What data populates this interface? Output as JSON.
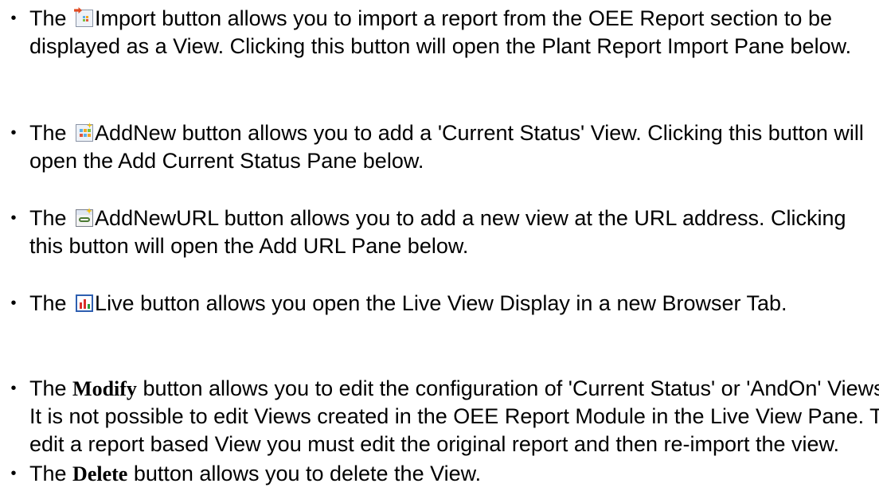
{
  "items": [
    {
      "lead": "The",
      "icon": "import-icon",
      "text": "Import button allows you to import a report from the OEE Report section to be displayed as a View. Clicking this button will open the Plant Report Import Pane below."
    },
    {
      "lead": "The",
      "icon": "add-new-icon",
      "text": "AddNew button allows you to add a 'Current Status' View. Clicking this button will open the Add Current Status Pane below."
    },
    {
      "lead": "The",
      "icon": "add-url-icon",
      "text": "AddNewURL button allows you to add a new view at the URL address. Clicking this button will open the Add URL Pane below."
    },
    {
      "lead": "The",
      "icon": "live-chart-icon",
      "text": "Live button allows you open the Live View Display in a new Browser Tab."
    },
    {
      "lead": "The",
      "bold": "Modify",
      "text": "button allows you to edit the configuration of 'Current Status' or 'AndOn' Views. It is not possible to edit Views created in the OEE Report Module in the Live View Pane. To edit a report based View you must edit the original report and then re-import the view."
    },
    {
      "lead": "The",
      "bold": "Delete",
      "text": "button allows you to delete the View."
    }
  ],
  "bullet_glyph": "•"
}
